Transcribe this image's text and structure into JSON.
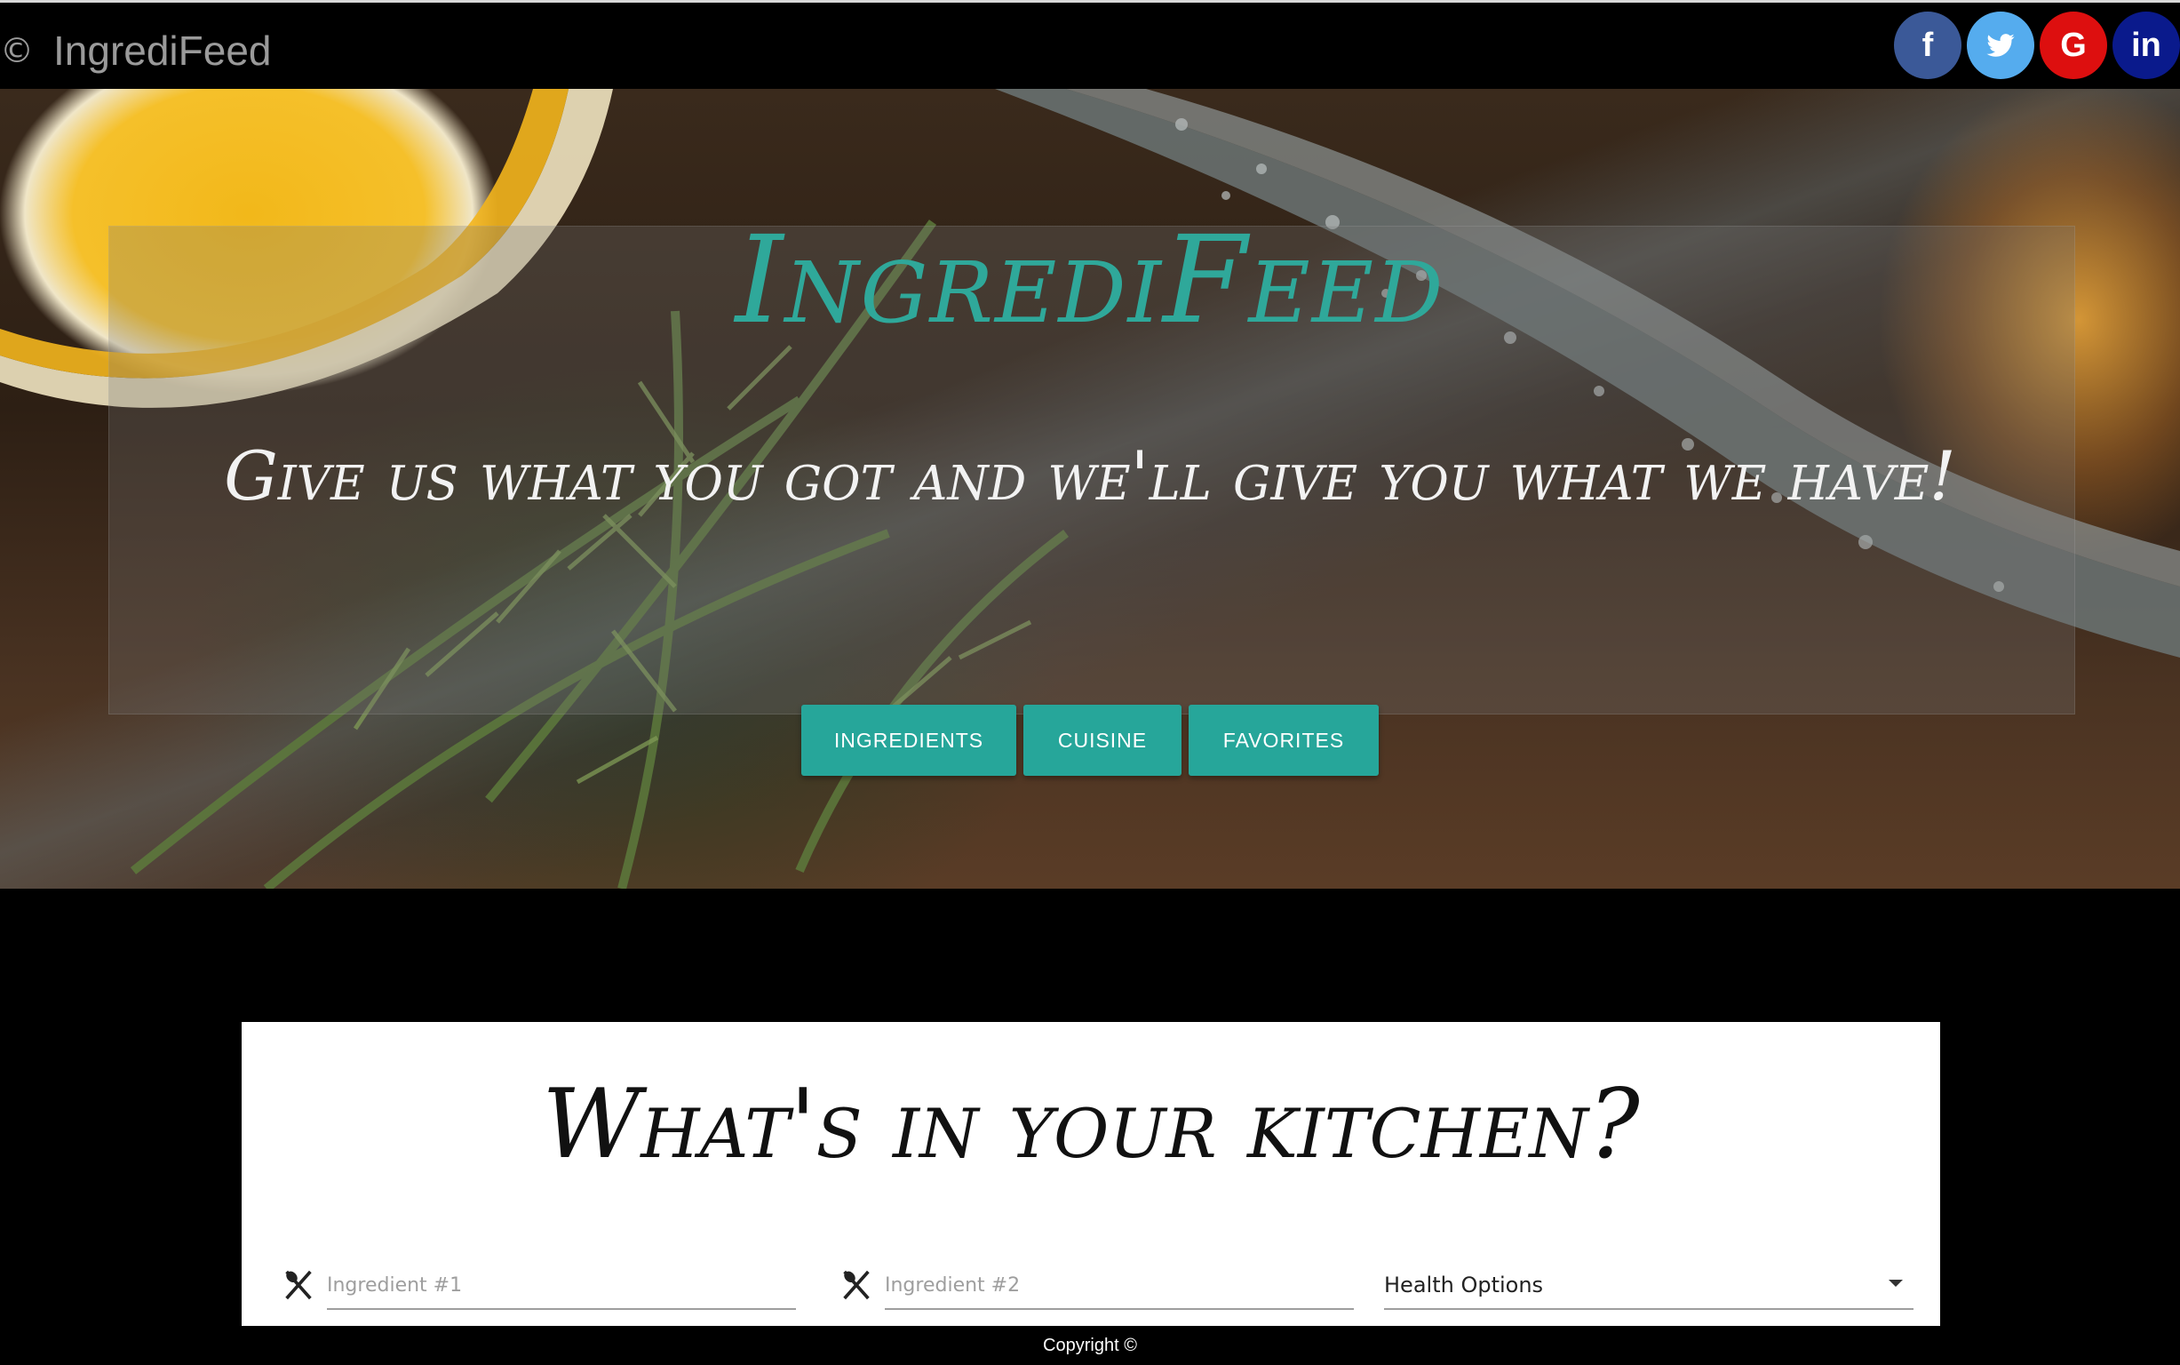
{
  "navbar": {
    "copyright_symbol": "©",
    "brand": "IngrediFeed",
    "social": [
      {
        "name": "facebook",
        "label": "f",
        "color": "#3b5998"
      },
      {
        "name": "twitter",
        "label": "twitter",
        "color": "#55acee"
      },
      {
        "name": "google",
        "label": "G",
        "color": "#dd0f0f"
      },
      {
        "name": "linkedin",
        "label": "in",
        "color": "#0a1a8c"
      }
    ]
  },
  "hero": {
    "title": "IngrediFeed",
    "tagline": "Give us what you got and we'll give you what we have!",
    "buttons": [
      "INGREDIENTS",
      "CUISINE",
      "FAVORITES"
    ]
  },
  "search": {
    "heading": "What's in your kitchen?",
    "ingredient1_placeholder": "Ingredient #1",
    "ingredient2_placeholder": "Ingredient #2",
    "health_options": "Health Options"
  },
  "footer": {
    "text": "Copyright ©"
  },
  "colors": {
    "accent": "#26a69a",
    "title_teal": "#2fa89a"
  }
}
